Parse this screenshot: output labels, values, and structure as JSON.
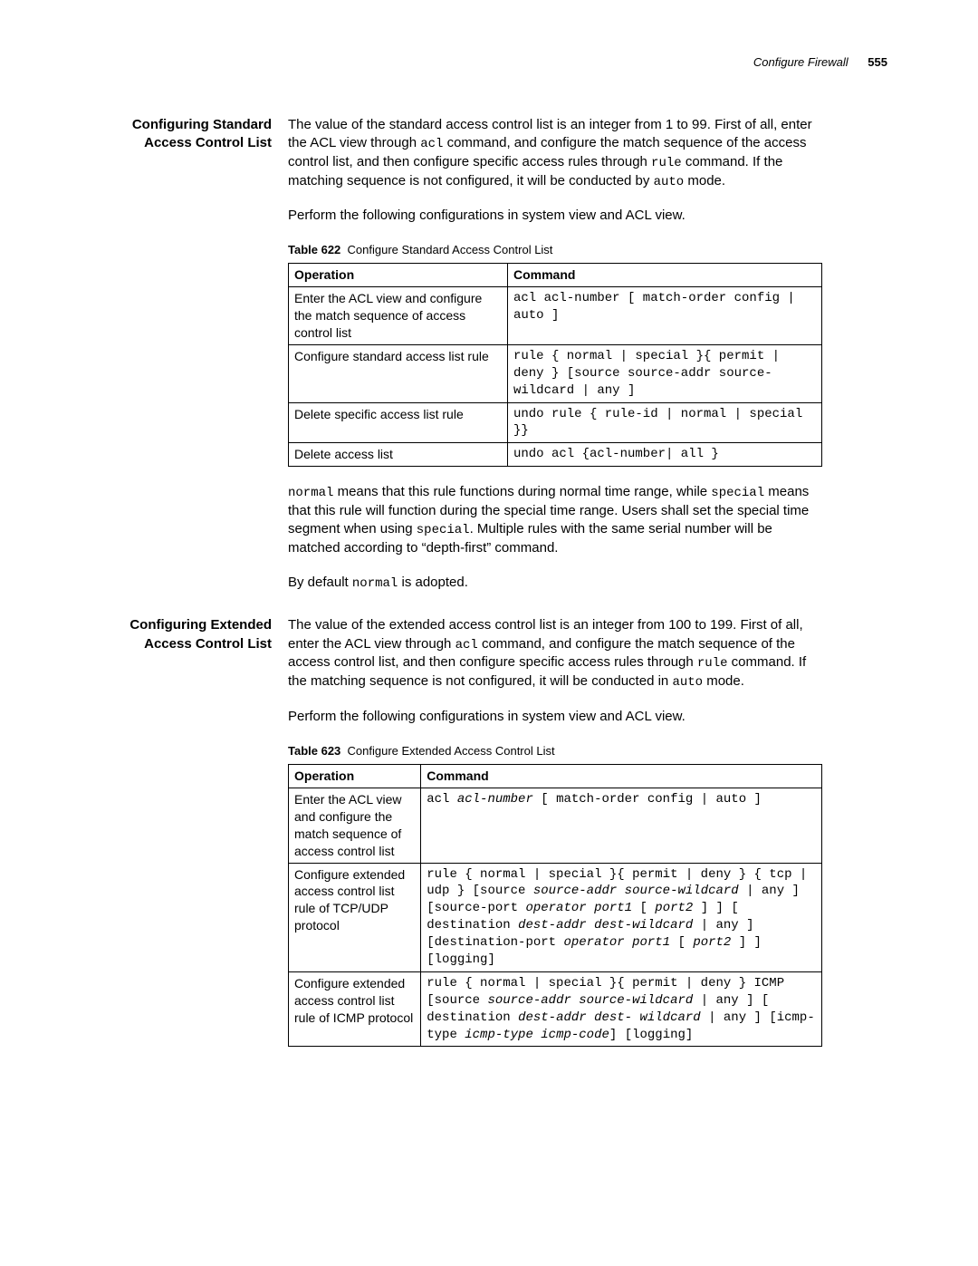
{
  "page_header": {
    "title": "Configure Firewall",
    "page_number": "555"
  },
  "sections": [
    {
      "heading": "Configuring Standard Access Control List",
      "paragraphs_before": [
        {
          "type": "rich",
          "parts": [
            {
              "t": "text",
              "v": "The value of the standard access control list is an integer from 1 to 99. First of all, enter the ACL view through "
            },
            {
              "t": "code",
              "v": "acl"
            },
            {
              "t": "text",
              "v": " command, and configure the match sequence of the access control list, and then configure specific access rules through "
            },
            {
              "t": "code",
              "v": "rule"
            },
            {
              "t": "text",
              "v": " command. If the matching sequence is not configured, it will be conducted by "
            },
            {
              "t": "code",
              "v": "auto"
            },
            {
              "t": "text",
              "v": " mode."
            }
          ]
        },
        {
          "type": "plain",
          "v": "Perform the following configurations in system view and ACL view."
        }
      ],
      "table": {
        "number": "622",
        "title": "Configure Standard Access Control List",
        "columns": [
          "Operation",
          "Command"
        ],
        "rows": [
          {
            "op": "Enter the ACL view and configure the match sequence of access control list",
            "cmd": [
              {
                "t": "text",
                "v": "acl acl-number [ match-order config | auto ]"
              }
            ]
          },
          {
            "op": "Configure standard access list rule",
            "cmd": [
              {
                "t": "text",
                "v": "rule { normal | special }{ permit | deny } [source source-addr source-wildcard | any ]"
              }
            ]
          },
          {
            "op": "Delete specific access list rule",
            "cmd": [
              {
                "t": "text",
                "v": "undo rule { rule-id | normal | special }}"
              }
            ]
          },
          {
            "op": "Delete access list",
            "cmd": [
              {
                "t": "text",
                "v": "undo acl {acl-number| all }"
              }
            ]
          }
        ]
      },
      "paragraphs_after": [
        {
          "type": "rich",
          "parts": [
            {
              "t": "code",
              "v": "normal"
            },
            {
              "t": "text",
              "v": " means that this rule functions during normal time range, while "
            },
            {
              "t": "code",
              "v": "special"
            },
            {
              "t": "text",
              "v": " means that this rule will function during the special time range. Users shall set the special time segment when using "
            },
            {
              "t": "code",
              "v": "special"
            },
            {
              "t": "text",
              "v": ". Multiple rules with the same serial number will be matched according to “depth-first” command."
            }
          ]
        },
        {
          "type": "rich",
          "parts": [
            {
              "t": "text",
              "v": "By default "
            },
            {
              "t": "code",
              "v": "normal"
            },
            {
              "t": "text",
              "v": " is adopted."
            }
          ]
        }
      ]
    },
    {
      "heading": "Configuring Extended Access Control List",
      "paragraphs_before": [
        {
          "type": "rich",
          "parts": [
            {
              "t": "text",
              "v": "The value of the extended access control list is an integer from 100 to 199. First of all, enter the ACL view through "
            },
            {
              "t": "code",
              "v": "acl"
            },
            {
              "t": "text",
              "v": " command, and configure the match sequence of the access control list, and then configure specific access rules through "
            },
            {
              "t": "code",
              "v": "rule"
            },
            {
              "t": "text",
              "v": " command. If the matching sequence is not configured, it will be conducted in "
            },
            {
              "t": "code",
              "v": "auto"
            },
            {
              "t": "text",
              "v": " mode."
            }
          ]
        },
        {
          "type": "plain",
          "v": "Perform the following configurations in system view and ACL view."
        }
      ],
      "table": {
        "number": "623",
        "title": "Configure Extended Access Control List",
        "columns": [
          "Operation",
          "Command"
        ],
        "rows": [
          {
            "op": "Enter the ACL view and configure the match sequence of access control list",
            "cmd": [
              {
                "t": "text",
                "v": "acl "
              },
              {
                "t": "ital",
                "v": "acl-number"
              },
              {
                "t": "text",
                "v": " [ match-order config | auto ]"
              }
            ]
          },
          {
            "op": "Configure extended access control list rule of TCP/UDP protocol",
            "cmd": [
              {
                "t": "text",
                "v": "rule { normal | special }{ permit | deny } { tcp | udp } [source "
              },
              {
                "t": "ital",
                "v": "source-addr source-wildcard"
              },
              {
                "t": "text",
                "v": " | any ] [source-port "
              },
              {
                "t": "ital",
                "v": "operator port1"
              },
              {
                "t": "text",
                "v": " [ "
              },
              {
                "t": "ital",
                "v": "port2"
              },
              {
                "t": "text",
                "v": " ] ] [ destination "
              },
              {
                "t": "ital",
                "v": "dest-addr dest-wildcard"
              },
              {
                "t": "text",
                "v": " | any ] [destination-port "
              },
              {
                "t": "ital",
                "v": "operator port1"
              },
              {
                "t": "text",
                "v": " [ "
              },
              {
                "t": "ital",
                "v": "port2"
              },
              {
                "t": "text",
                "v": " ] ] [logging]"
              }
            ]
          },
          {
            "op": "Configure extended access control list rule of ICMP protocol",
            "cmd": [
              {
                "t": "text",
                "v": "rule { normal | special }{ permit | deny } ICMP [source "
              },
              {
                "t": "ital",
                "v": "source-addr source-wildcard"
              },
              {
                "t": "text",
                "v": " | any ] [ destination "
              },
              {
                "t": "ital",
                "v": "dest-addr dest- wildcard"
              },
              {
                "t": "text",
                "v": " | any ] [icmp-type "
              },
              {
                "t": "ital",
                "v": "icmp-type icmp-code"
              },
              {
                "t": "text",
                "v": "] [logging]"
              }
            ]
          }
        ]
      },
      "paragraphs_after": []
    }
  ]
}
